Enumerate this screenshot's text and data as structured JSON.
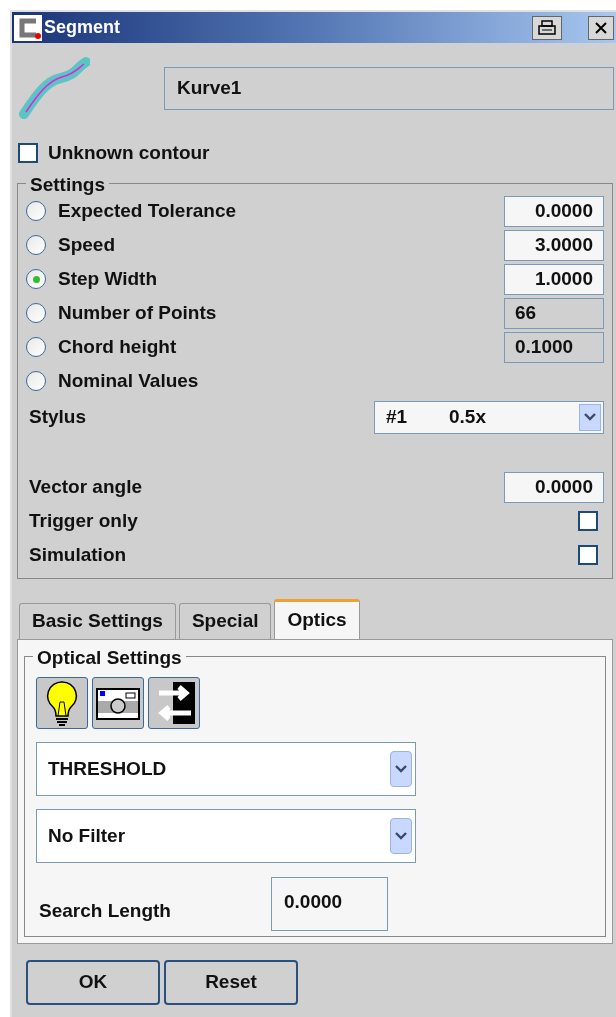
{
  "window": {
    "title": "Segment"
  },
  "name_field": {
    "value": "Kurve1"
  },
  "unknown_contour": {
    "label": "Unknown contour",
    "checked": false
  },
  "settings": {
    "title": "Settings",
    "options": [
      {
        "label": "Expected Tolerance",
        "selected": false,
        "value": "0.0000",
        "disabled": false
      },
      {
        "label": "Speed",
        "selected": false,
        "value": "3.0000",
        "disabled": false
      },
      {
        "label": "Step Width",
        "selected": true,
        "value": "1.0000",
        "disabled": false
      },
      {
        "label": "Number of Points",
        "selected": false,
        "value": "66",
        "disabled": true
      },
      {
        "label": "Chord height",
        "selected": false,
        "value": "0.1000",
        "disabled": true
      },
      {
        "label": "Nominal Values",
        "selected": false
      }
    ],
    "stylus": {
      "label": "Stylus",
      "number": "#1",
      "value": "0.5x"
    },
    "vector_angle": {
      "label": "Vector angle",
      "value": "0.0000"
    },
    "checks": [
      {
        "label": "Trigger only",
        "checked": false
      },
      {
        "label": "Simulation",
        "checked": false
      }
    ]
  },
  "tabs": [
    {
      "label": "Basic Settings",
      "selected": false
    },
    {
      "label": "Special",
      "selected": false
    },
    {
      "label": "Optics",
      "selected": true
    }
  ],
  "optical": {
    "title": "Optical Settings",
    "dropdowns": [
      {
        "value": "THRESHOLD"
      },
      {
        "value": "No Filter"
      }
    ],
    "search_length": {
      "label": "Search Length",
      "value": "0.0000"
    }
  },
  "buttons": [
    "OK",
    "Reset"
  ]
}
